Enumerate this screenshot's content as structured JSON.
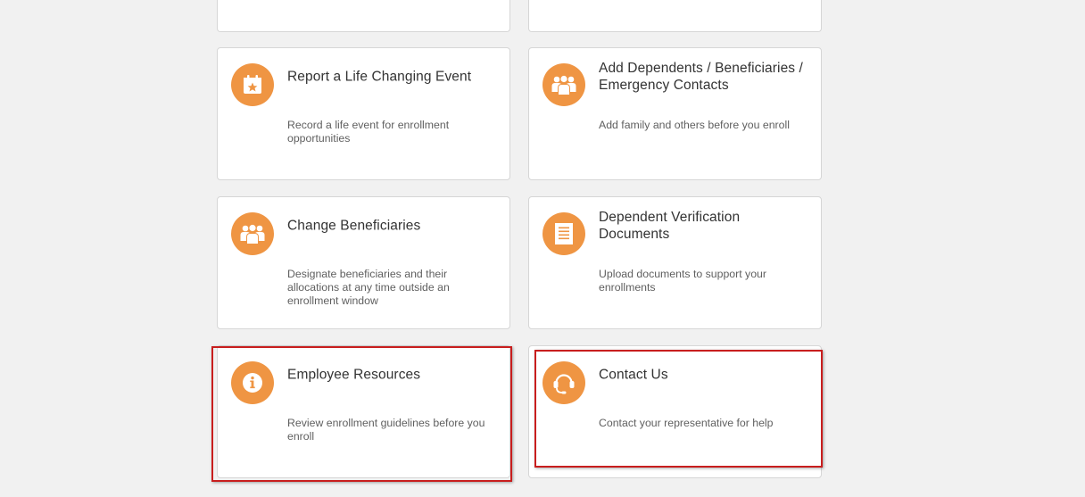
{
  "tiles": [
    {
      "title": "Report a Life Changing Event",
      "description": "Record a life event for enrollment opportunities",
      "icon": "calendar-star-icon"
    },
    {
      "title": "Add Dependents / Beneficiaries / Emergency Contacts",
      "description": "Add family and others before you enroll",
      "icon": "people-group-icon"
    },
    {
      "title": "Change Beneficiaries",
      "description": "Designate beneficiaries and their allocations at any time outside an enrollment window",
      "icon": "people-group-icon"
    },
    {
      "title": "Dependent Verification Documents",
      "description": "Upload documents to support your enrollments",
      "icon": "document-icon"
    },
    {
      "title": "Employee Resources",
      "description": "Review enrollment guidelines before you enroll",
      "icon": "info-icon"
    },
    {
      "title": "Contact Us",
      "description": "Contact your representative for help",
      "icon": "headset-icon"
    }
  ],
  "colors": {
    "background": "#f1f1f1",
    "card": "#ffffff",
    "icon_accent": "#ef9543",
    "highlight_box": "#c81e1e"
  }
}
